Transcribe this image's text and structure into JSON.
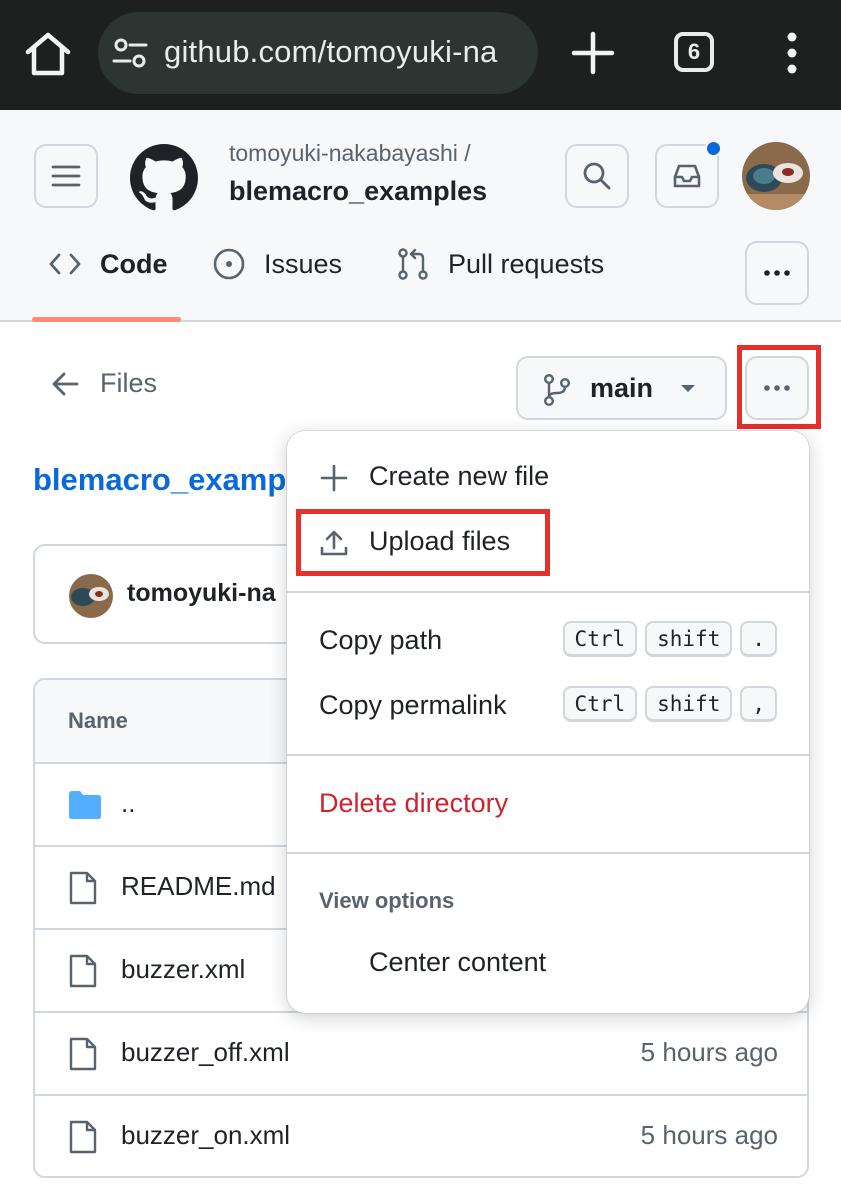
{
  "browser": {
    "url": "github.com/tomoyuki-na",
    "tab_count": "6"
  },
  "header": {
    "owner": "tomoyuki-nakabayashi /",
    "repo": "blemacro_examples"
  },
  "tabs": [
    {
      "label": "Code",
      "icon": "code-icon"
    },
    {
      "label": "Issues",
      "icon": "issue-icon"
    },
    {
      "label": "Pull requests",
      "icon": "pull-request-icon"
    }
  ],
  "nav": {
    "files_label": "Files",
    "branch": "main"
  },
  "directory": {
    "title": "blemacro_exampl"
  },
  "commit": {
    "author": "tomoyuki-na"
  },
  "table": {
    "name_header": "Name",
    "rows": [
      {
        "name": "..",
        "type": "folder",
        "time": ""
      },
      {
        "name": "README.md",
        "type": "file",
        "time": ""
      },
      {
        "name": "buzzer.xml",
        "type": "file",
        "time": ""
      },
      {
        "name": "buzzer_off.xml",
        "type": "file",
        "time": "5 hours ago"
      },
      {
        "name": "buzzer_on.xml",
        "type": "file",
        "time": "5 hours ago"
      }
    ]
  },
  "menu": {
    "create_new_file": "Create new file",
    "upload_files": "Upload files",
    "copy_path": "Copy path",
    "copy_path_keys": [
      "Ctrl",
      "shift",
      "."
    ],
    "copy_permalink": "Copy permalink",
    "copy_permalink_keys": [
      "Ctrl",
      "shift",
      ","
    ],
    "delete_directory": "Delete directory",
    "view_options_title": "View options",
    "center_content": "Center content"
  },
  "colors": {
    "accent_link": "#0969da",
    "danger": "#cf222e",
    "highlight": "#e5302c",
    "tab_underline": "#fd8c73"
  }
}
